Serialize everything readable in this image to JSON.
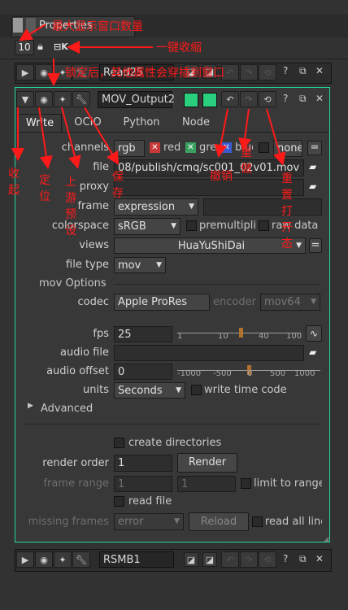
{
  "window": {
    "title": "Properties",
    "max_panels": "10"
  },
  "read_node": {
    "name": "Read25"
  },
  "write_node": {
    "name": "MOV_Output2"
  },
  "rsmb_node": {
    "name": "RSMB1"
  },
  "tabs": [
    {
      "label": "Write"
    },
    {
      "label": "OCIO"
    },
    {
      "label": "Python"
    },
    {
      "label": "Node"
    }
  ],
  "fields": {
    "channels": {
      "label": "channels",
      "value": "rgb",
      "r": "red",
      "g": "green",
      "b": "blue",
      "a": "none"
    },
    "file": {
      "label": "file",
      "value": "08/publish/cmq/sc001_02v01.mov"
    },
    "proxy": {
      "label": "proxy",
      "value": ""
    },
    "frame": {
      "label": "frame",
      "value": "expression"
    },
    "colorspace": {
      "label": "colorspace",
      "value": "sRGB",
      "premult": "premultiplied",
      "raw": "raw data"
    },
    "views": {
      "label": "views",
      "value": "HuaYuShiDai"
    },
    "file_type": {
      "label": "file type",
      "value": "mov"
    },
    "mov_options": "mov Options",
    "codec": {
      "label": "codec",
      "value": "Apple ProRes",
      "encoder_label": "encoder",
      "encoder_value": "mov64"
    },
    "fps": {
      "label": "fps",
      "value": "25",
      "ticks": [
        "1",
        "10",
        "40",
        "100"
      ]
    },
    "audio_file": {
      "label": "audio file",
      "value": ""
    },
    "audio_offset": {
      "label": "audio offset",
      "value": "0",
      "ticks": [
        "-1000",
        "-500",
        "0",
        "500",
        "1000"
      ]
    },
    "units": {
      "label": "units",
      "value": "Seconds",
      "timecode": "write time code"
    },
    "advanced": "Advanced",
    "create_dirs": "create directories",
    "render_order": {
      "label": "render order",
      "value": "1",
      "button": "Render"
    },
    "frame_range": {
      "label": "frame range",
      "v1": "1",
      "v2": "1",
      "limit": "limit to range"
    },
    "read_file": "read file",
    "missing_frames": {
      "label": "missing frames",
      "value": "error",
      "button": "Reload",
      "read_all": "read all lines"
    }
  },
  "annotations": {
    "max_windows": "最大显示窗口数量",
    "collapse_all": "一键收缩",
    "lock_note": "锁定后，其他属性会穿插到窗口",
    "collapse": "收起",
    "locate": "定位",
    "upstream_preset": "上游预设",
    "save": "保存",
    "undo": "撤销",
    "redo": "重做",
    "reopen": "重置打开态"
  },
  "colors": {
    "panel_border": "#1fd6a0",
    "annotation": "#ff1a1a",
    "green_swatch": "#2ad07e"
  }
}
